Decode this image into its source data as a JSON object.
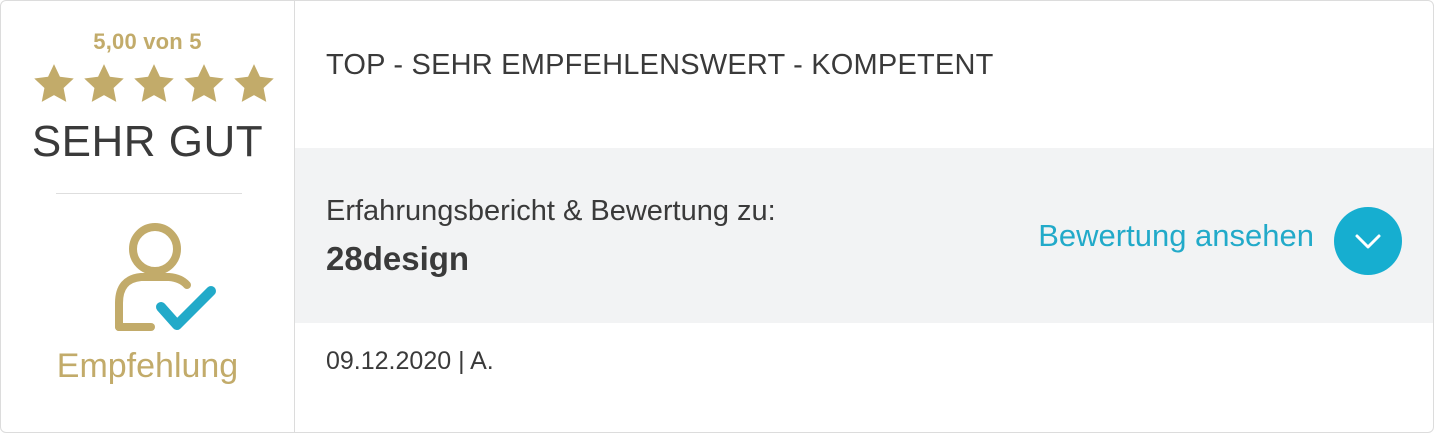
{
  "rating": {
    "score_text": "5,00 von 5",
    "stars_filled": 5,
    "stars_total": 5,
    "grade": "SEHR GUT",
    "recommendation": "Empfehlung"
  },
  "review": {
    "title": "TOP - SEHR EMPFEHLENSWERT - KOMPETENT",
    "report_label": "Erfahrungsbericht & Bewertung zu:",
    "company": "28design",
    "view_link": "Bewertung ansehen",
    "meta": "09.12.2020 | A."
  },
  "icons": {
    "star": "star-icon",
    "recommendation": "person-check-icon",
    "expand": "chevron-down-icon"
  },
  "colors": {
    "gold": "#c2ab6a",
    "accent": "#16aed0",
    "text": "#3a3a3a",
    "band": "#f2f3f4"
  }
}
